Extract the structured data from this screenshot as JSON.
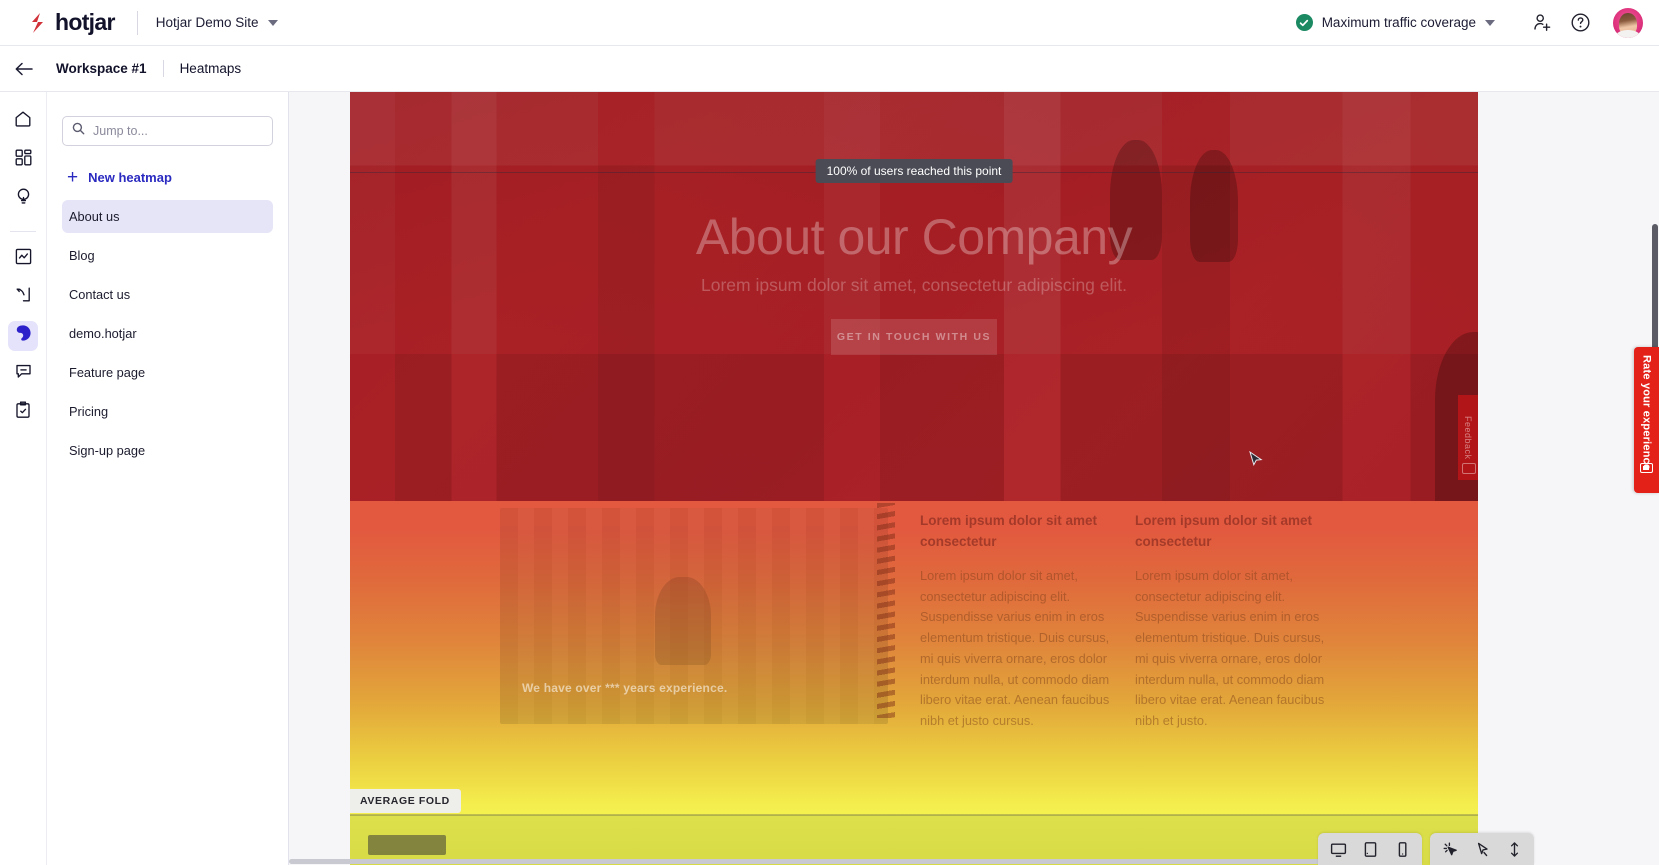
{
  "topbar": {
    "brand_name": "hotjar",
    "brand_logo_icon": "hotjar-logo-icon",
    "site_name": "Hotjar Demo Site",
    "site_caret_icon": "chevron-down-icon",
    "coverage_label": "Maximum traffic coverage",
    "coverage_status_icon": "check-circle-icon",
    "coverage_status_color": "#1b8a63",
    "coverage_caret_icon": "chevron-down-icon",
    "invite_icon": "add-user-icon",
    "help_icon": "question-circle-icon",
    "avatar_icon": "user-avatar"
  },
  "breadcrumb": {
    "back_icon": "arrow-left-icon",
    "workspace": "Workspace #1",
    "current": "Heatmaps"
  },
  "rail": {
    "items": [
      {
        "name": "home",
        "icon": "home-icon",
        "active": false
      },
      {
        "name": "dashboards",
        "icon": "dashboard-grid-icon",
        "active": false
      },
      {
        "name": "highlights",
        "icon": "lightbulb-icon",
        "active": false
      },
      {
        "name": "trends",
        "icon": "trends-chart-icon",
        "active": false
      },
      {
        "name": "funnels",
        "icon": "funnel-arrow-icon",
        "active": false
      },
      {
        "name": "heatmaps",
        "icon": "heatmap-icon",
        "active": true
      },
      {
        "name": "feedback",
        "icon": "speech-bubble-icon",
        "active": false
      },
      {
        "name": "surveys",
        "icon": "clipboard-check-icon",
        "active": false
      }
    ]
  },
  "pages_panel": {
    "search_placeholder": "Jump to...",
    "search_value": "",
    "search_icon": "search-icon",
    "new_heatmap_label": "New heatmap",
    "new_heatmap_icon": "plus-icon",
    "items": [
      {
        "label": "About us",
        "active": true
      },
      {
        "label": "Blog",
        "active": false
      },
      {
        "label": "Contact us",
        "active": false
      },
      {
        "label": "demo.hotjar",
        "active": false
      },
      {
        "label": "Feature page",
        "active": false
      },
      {
        "label": "Pricing",
        "active": false
      },
      {
        "label": "Sign-up page",
        "active": false
      }
    ]
  },
  "heatmap": {
    "scroll_marker_label": "100% of users reached this point",
    "average_fold_label": "AVERAGE FOLD",
    "gradient_top_color": "#b0181e",
    "gradient_mid_color": "#e0873b",
    "gradient_bottom_color": "#f6f64f"
  },
  "page_preview": {
    "hero_title": "About our Company",
    "hero_subtitle": "Lorem ipsum dolor sit amet, consectetur adipiscing elit.",
    "hero_cta": "GET IN TOUCH WITH US",
    "feedback_tab_label": "Feedback",
    "photo_caption": "We have over *** years experience.",
    "columns": [
      {
        "heading": "Lorem ipsum dolor sit amet consectetur",
        "body": "Lorem ipsum dolor sit amet, consectetur adipiscing elit. Suspendisse varius enim in eros elementum tristique. Duis cursus, mi quis viverra ornare, eros dolor interdum nulla, ut commodo diam libero vitae erat. Aenean faucibus nibh et justo cursus."
      },
      {
        "heading": "Lorem ipsum dolor sit amet consectetur",
        "body": "Lorem ipsum dolor sit amet, consectetur adipiscing elit. Suspendisse varius enim in eros elementum tristique. Duis cursus, mi quis viverra ornare, eros dolor interdum nulla, ut commodo diam libero vitae erat. Aenean faucibus nibh et justo."
      }
    ]
  },
  "bottom_toolbar": {
    "devices": [
      {
        "name": "desktop",
        "icon": "desktop-icon",
        "active": true
      },
      {
        "name": "tablet",
        "icon": "tablet-icon",
        "active": false
      },
      {
        "name": "mobile",
        "icon": "mobile-icon",
        "active": false
      }
    ],
    "modes": [
      {
        "name": "click",
        "icon": "click-pointer-icon",
        "active": true
      },
      {
        "name": "move",
        "icon": "move-cursor-icon",
        "active": false
      },
      {
        "name": "scroll",
        "icon": "scroll-updown-icon",
        "active": false
      }
    ]
  },
  "rate_widget": {
    "label": "Rate your experience",
    "icon": "rate-card-icon",
    "color": "#e32119"
  }
}
